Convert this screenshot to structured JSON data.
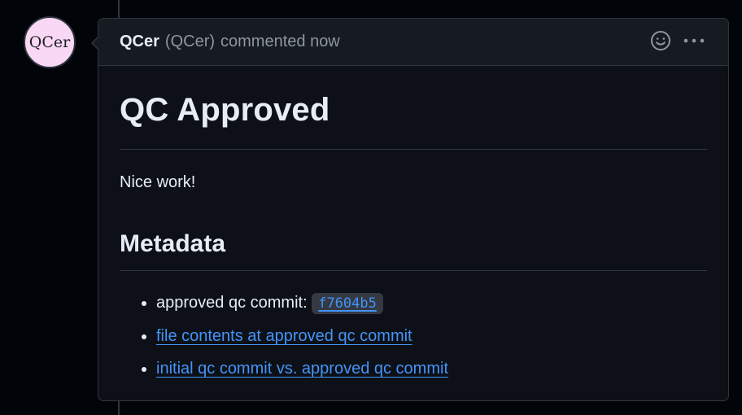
{
  "avatar": {
    "initials": "QCer"
  },
  "comment": {
    "author": "QCer",
    "author_handle": "(QCer)",
    "action": "commented now",
    "icons": {
      "reaction": "smiley-icon",
      "menu": "kebab-horizontal-icon"
    }
  },
  "body": {
    "title": "QC Approved",
    "message": "Nice work!",
    "section_heading": "Metadata",
    "items": {
      "approved_label": "approved qc commit: ",
      "approved_commit": "f7604b5",
      "file_contents_link": "file contents at approved qc commit",
      "diff_link": "initial qc commit vs. approved qc commit"
    }
  },
  "colors": {
    "background": "#010409",
    "card": "#0d1117",
    "header": "#161b22",
    "border": "#30363d",
    "link": "#4493f8",
    "text": "#e6edf3",
    "muted": "#8d96a0",
    "avatar_bg": "#f9d8f6"
  }
}
